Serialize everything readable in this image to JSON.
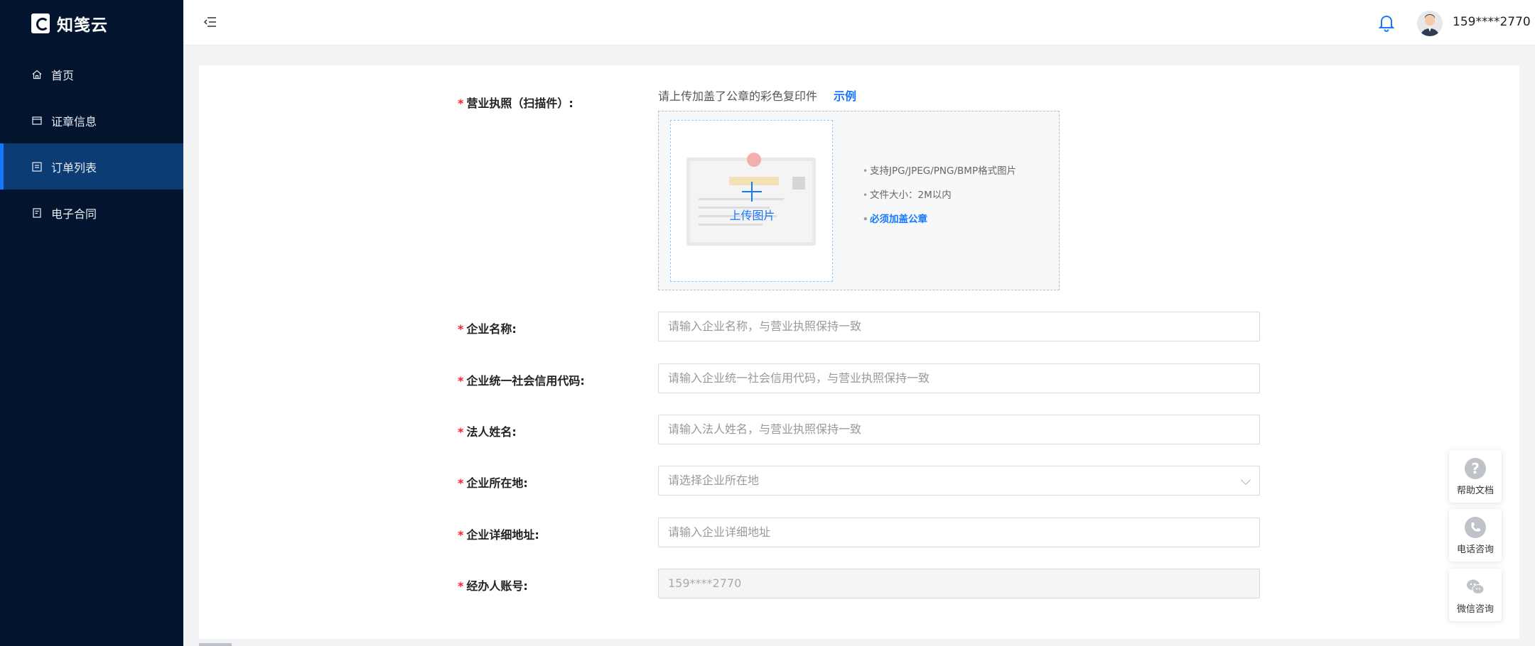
{
  "brand": {
    "name": "知笺云"
  },
  "sidebar": {
    "items": [
      {
        "label": "首页",
        "icon": "home-icon",
        "active": false
      },
      {
        "label": "证章信息",
        "icon": "seal-icon",
        "active": false
      },
      {
        "label": "订单列表",
        "icon": "list-icon",
        "active": true
      },
      {
        "label": "电子合同",
        "icon": "contract-icon",
        "active": false
      }
    ]
  },
  "header": {
    "username": "159****2770"
  },
  "form": {
    "license": {
      "label": "营业执照（扫描件）:",
      "hint": "请上传加盖了公章的彩色复印件",
      "example": "示例",
      "upload_text": "上传图片",
      "tips": [
        "支持JPG/JPEG/PNG/BMP格式图片",
        "文件大小：2M以内",
        "必须加盖公章"
      ]
    },
    "company_name": {
      "label": "企业名称:",
      "placeholder": "请输入企业名称，与营业执照保持一致"
    },
    "credit_code": {
      "label": "企业统一社会信用代码:",
      "placeholder": "请输入企业统一社会信用代码，与营业执照保持一致"
    },
    "legal_person": {
      "label": "法人姓名:",
      "placeholder": "请输入法人姓名，与营业执照保持一致"
    },
    "location": {
      "label": "企业所在地:",
      "placeholder": "请选择企业所在地"
    },
    "address": {
      "label": "企业详细地址:",
      "placeholder": "请输入企业详细地址"
    },
    "account": {
      "label": "经办人账号:",
      "value": "159****2770"
    }
  },
  "float_tools": [
    {
      "label": "帮助文档",
      "icon": "question-icon"
    },
    {
      "label": "电话咨询",
      "icon": "phone-icon"
    },
    {
      "label": "微信咨询",
      "icon": "wechat-icon"
    }
  ],
  "colors": {
    "sidebar_bg": "#03142e",
    "active_bg": "#0b3c73",
    "accent": "#1677ff",
    "required": "#f5222d"
  }
}
